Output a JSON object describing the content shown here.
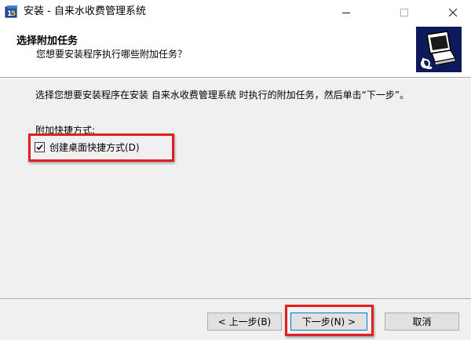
{
  "window": {
    "title": "安装 - 自来水收费管理系统",
    "icon": "installer-app-icon",
    "controls": {
      "minimize_icon": "minimize-icon",
      "maximize_icon": "maximize-icon",
      "close_icon": "close-icon"
    }
  },
  "header": {
    "title": "选择附加任务",
    "subtitle": "您想要安装程序执行哪些附加任务？",
    "image": "wizard-computer-image"
  },
  "body": {
    "description": "选择您想要安装程序在安装 自来水收费管理系统 时执行的附加任务，然后单击“下一步”。",
    "group_label": "附加快捷方式:",
    "tasks": [
      {
        "label": "创建桌面快捷方式(D)",
        "checked": true
      }
    ]
  },
  "footer": {
    "back_label": "< 上一步(B)",
    "next_label": "下一步(N) >",
    "cancel_label": "取消"
  },
  "colors": {
    "highlight": "#e02020",
    "header_image_bg": "#0c1a5a",
    "focus_border": "#0078d7"
  }
}
